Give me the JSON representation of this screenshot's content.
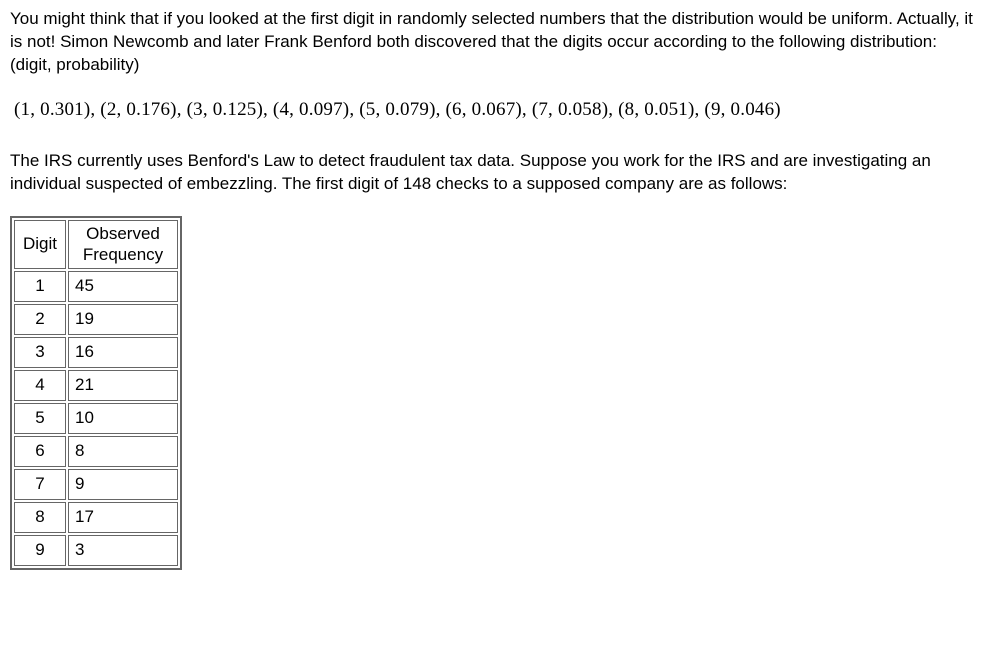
{
  "paragraph1": "You might think that if you looked at the first digit in randomly selected numbers that the distribution would be uniform. Actually, it is not! Simon Newcomb and later Frank Benford both discovered that the digits occur according to the following distribution: (digit, probability)",
  "distribution": "(1, 0.301), (2, 0.176), (3, 0.125), (4, 0.097), (5, 0.079), (6, 0.067), (7, 0.058), (8, 0.051), (9, 0.046)",
  "paragraph2": "The IRS currently uses Benford's Law to detect fraudulent tax data. Suppose you work for the IRS and are investigating an individual suspected of embezzling. The first digit of 148 checks to a supposed company are as follows:",
  "table": {
    "header_digit": "Digit",
    "header_freq_line1": "Observed",
    "header_freq_line2": "Frequency",
    "rows": [
      {
        "digit": "1",
        "freq": "45"
      },
      {
        "digit": "2",
        "freq": "19"
      },
      {
        "digit": "3",
        "freq": "16"
      },
      {
        "digit": "4",
        "freq": "21"
      },
      {
        "digit": "5",
        "freq": "10"
      },
      {
        "digit": "6",
        "freq": "8"
      },
      {
        "digit": "7",
        "freq": "9"
      },
      {
        "digit": "8",
        "freq": "17"
      },
      {
        "digit": "9",
        "freq": "3"
      }
    ]
  }
}
